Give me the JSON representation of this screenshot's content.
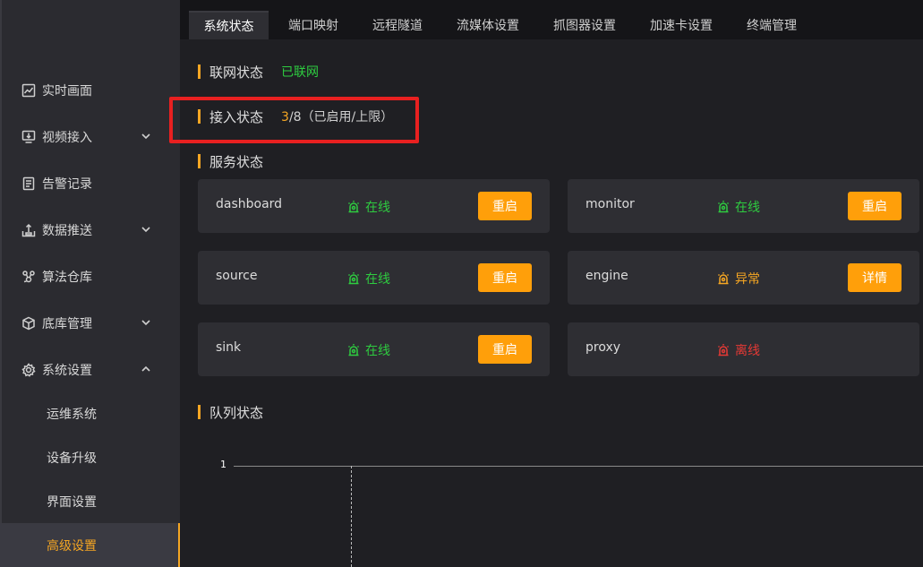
{
  "sidebar": {
    "items": [
      {
        "label": "实时画面",
        "icon": "chart-line-icon"
      },
      {
        "label": "视频接入",
        "icon": "monitor-download-icon",
        "chevron": "down"
      },
      {
        "label": "告警记录",
        "icon": "document-list-icon"
      },
      {
        "label": "数据推送",
        "icon": "upload-tray-icon",
        "chevron": "down"
      },
      {
        "label": "算法仓库",
        "icon": "algorithm-icon"
      },
      {
        "label": "底库管理",
        "icon": "cube-icon",
        "chevron": "down"
      },
      {
        "label": "系统设置",
        "icon": "gear-icon",
        "chevron": "up"
      }
    ],
    "sub_items": [
      {
        "label": "运维系统"
      },
      {
        "label": "设备升级"
      },
      {
        "label": "界面设置"
      },
      {
        "label": "高级设置",
        "active": true
      }
    ]
  },
  "tabs": [
    {
      "label": "系统状态",
      "active": true
    },
    {
      "label": "端口映射"
    },
    {
      "label": "远程隧道"
    },
    {
      "label": "流媒体设置"
    },
    {
      "label": "抓图器设置"
    },
    {
      "label": "加速卡设置"
    },
    {
      "label": "终端管理"
    }
  ],
  "network": {
    "label": "联网状态",
    "value": "已联网"
  },
  "access": {
    "label": "接入状态",
    "count": "3",
    "total": "/8（已启用/上限）"
  },
  "services": {
    "title": "服务状态",
    "items": [
      {
        "name": "dashboard",
        "status": "在线",
        "state": "online",
        "button": "重启"
      },
      {
        "name": "monitor",
        "status": "在线",
        "state": "online",
        "button": "重启"
      },
      {
        "name": "source",
        "status": "在线",
        "state": "online",
        "button": "重启"
      },
      {
        "name": "engine",
        "status": "异常",
        "state": "abnormal",
        "button": "详情"
      },
      {
        "name": "sink",
        "status": "在线",
        "state": "online",
        "button": "重启"
      },
      {
        "name": "proxy",
        "status": "离线",
        "state": "offline",
        "button": ""
      }
    ]
  },
  "queue": {
    "title": "队列状态",
    "ytick": "1"
  },
  "colors": {
    "accent": "#f5a623",
    "online": "#2ecc40",
    "offline": "#e53935",
    "button": "#ff9f0a",
    "highlight": "#e82020"
  }
}
